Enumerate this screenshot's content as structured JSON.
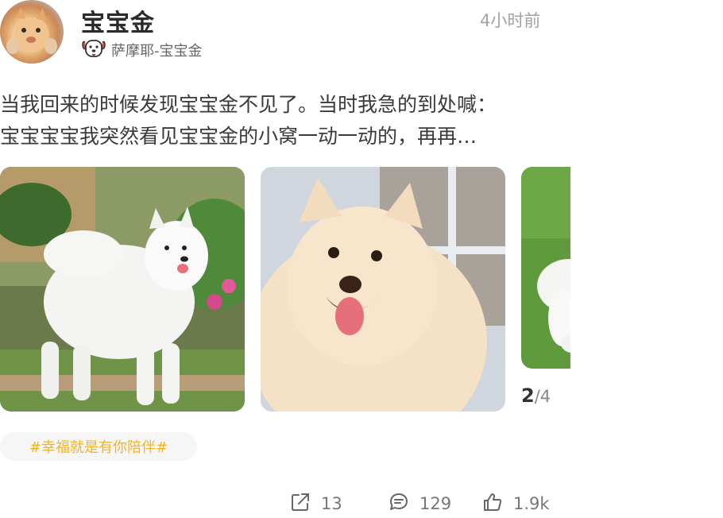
{
  "post": {
    "username": "宝宝金",
    "time": "4小时前",
    "breed_label": "萨摩耶-宝宝金",
    "text_line1": "当我回来的时候发现宝宝金不见了。当时我急的到处喊：",
    "text_line2": "宝宝宝宝我突然看见宝宝金的小窝一动一动的，再再…",
    "image_counter": {
      "current": "2",
      "total": "/4"
    },
    "tag": "#幸福就是有你陪伴#"
  },
  "actions": {
    "share_count": "13",
    "comment_count": "129",
    "like_count": "1.9k"
  },
  "icons": {
    "breed": "dog-face-icon",
    "share": "share-icon",
    "comment": "comment-icon",
    "like": "thumbs-up-icon"
  },
  "colors": {
    "tag_text": "#f0b527",
    "tag_bg": "#f6f6f6",
    "time": "#a3a3a3"
  }
}
